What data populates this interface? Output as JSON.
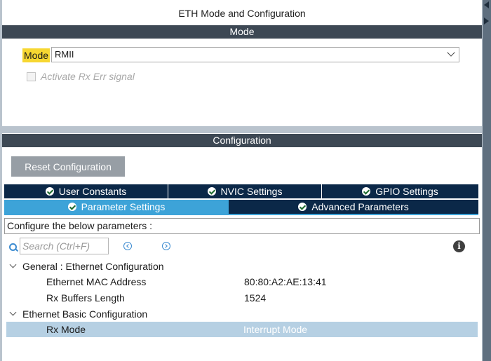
{
  "window": {
    "title": "ETH Mode and Configuration"
  },
  "mode_section": {
    "header": "Mode",
    "mode_label": "Mode",
    "mode_value": "RMII",
    "checkbox_label": "Activate Rx Err signal",
    "checkbox_checked": false
  },
  "config_section": {
    "header": "Configuration",
    "reset_button": "Reset Configuration",
    "tabs_row1": [
      "User Constants",
      "NVIC Settings",
      "GPIO Settings"
    ],
    "tabs_row2": [
      "Parameter Settings",
      "Advanced Parameters"
    ],
    "active_tab": "Parameter Settings",
    "hint": "Configure the below parameters :",
    "search_placeholder": "Search (Ctrl+F)",
    "info_glyph": "i",
    "groups": [
      {
        "title": "General : Ethernet Configuration",
        "items": [
          {
            "name": "Ethernet MAC Address",
            "value": "80:80:A2:AE:13:41"
          },
          {
            "name": "Rx Buffers Length",
            "value": "1524"
          }
        ]
      },
      {
        "title": "Ethernet Basic Configuration",
        "items": [
          {
            "name": "Rx Mode",
            "value": "Interrupt Mode",
            "selected": true
          }
        ]
      }
    ]
  },
  "colors": {
    "accent_tab": "#3da3d8",
    "tab_dark": "#0b2848",
    "section_bar": "#3d4854",
    "highlight": "#f7d731",
    "selected_row": "#b6d0e3"
  },
  "icons": [
    "chevron-down-icon",
    "check-circle-icon",
    "search-icon",
    "previous-icon",
    "next-icon",
    "info-icon",
    "expand-icon",
    "collapse-arrow-icon"
  ]
}
